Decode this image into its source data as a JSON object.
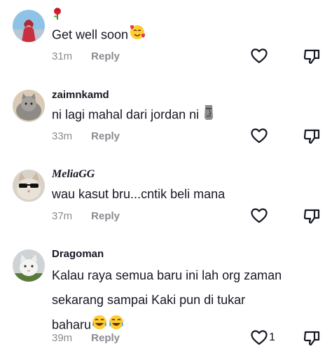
{
  "comments": [
    {
      "username": "",
      "text": "Get well soon",
      "time": "31m",
      "reply_label": "Reply",
      "likes": ""
    },
    {
      "username": "zaimnkamd",
      "text": "ni lagi mahal dari jordan ni",
      "time": "33m",
      "reply_label": "Reply",
      "likes": ""
    },
    {
      "username": "MeliaGG",
      "text": "wau kasut bru...cntik beli mana",
      "time": "37m",
      "reply_label": "Reply",
      "likes": ""
    },
    {
      "username": "Dragoman",
      "text_lines": [
        "Kalau raya semua baru ini lah org zaman",
        "sekarang sampai Kaki pun di tukar",
        "baharu"
      ],
      "time": "39m",
      "reply_label": "Reply",
      "likes": "1"
    }
  ],
  "icons": {
    "like": "heart-outline-icon",
    "dislike": "thumbs-down-icon",
    "username_rose": "rose-emoji-icon",
    "emoji_heart_face": "smiling-face-with-hearts-icon",
    "emoji_moai": "moai-icon",
    "emoji_laugh": "tears-of-joy-icon"
  },
  "colors": {
    "text": "#161823",
    "meta": "#8a8b91",
    "background": "#ffffff"
  }
}
